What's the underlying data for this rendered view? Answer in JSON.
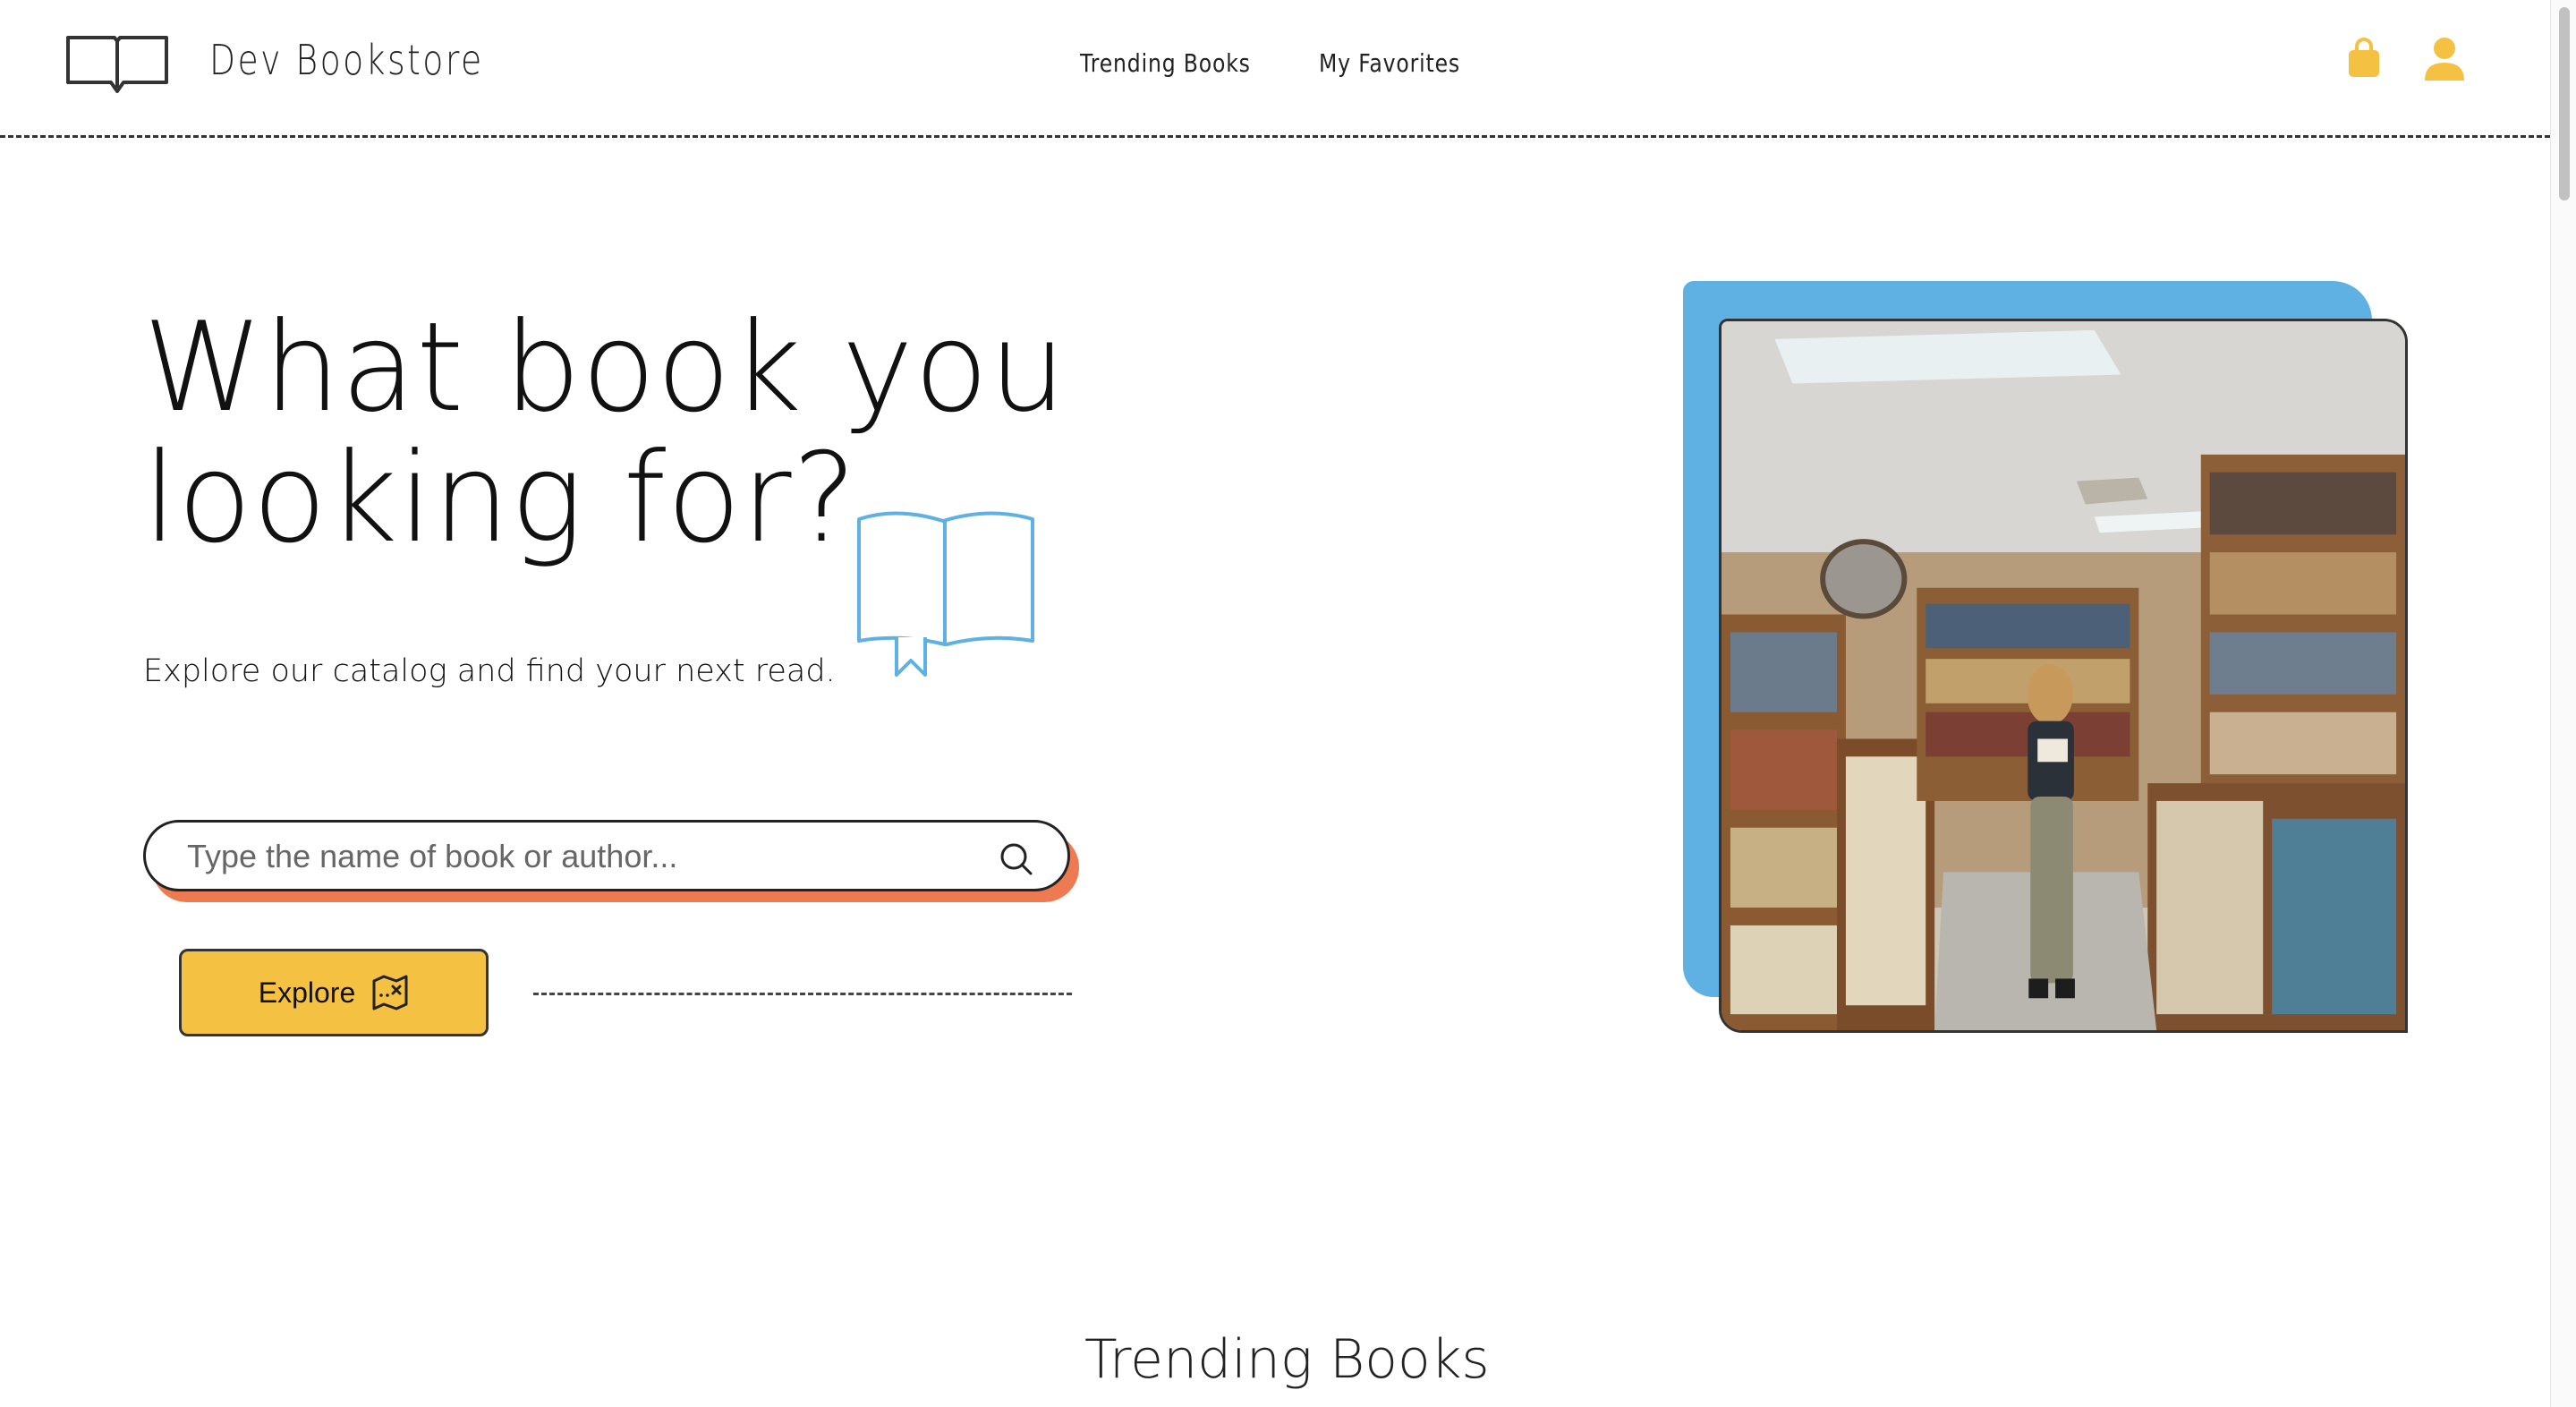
{
  "brand": {
    "name": "Dev Bookstore"
  },
  "nav": {
    "trending": "Trending Books",
    "favorites": "My Favorites"
  },
  "hero": {
    "title_line1": "What book you",
    "title_line2": "looking for?",
    "subtitle": "Explore our catalog and find your next read.",
    "search_placeholder": "Type the name of book or author...",
    "explore_label": "Explore"
  },
  "sections": {
    "trending_title": "Trending Books"
  },
  "colors": {
    "accent_yellow": "#f4c142",
    "accent_blue": "#5fb1e3",
    "accent_orange": "#ee7a52"
  },
  "icons": [
    "open-book-logo-icon",
    "shopping-bag-icon",
    "user-icon",
    "open-book-icon",
    "search-icon",
    "treasure-map-icon"
  ]
}
